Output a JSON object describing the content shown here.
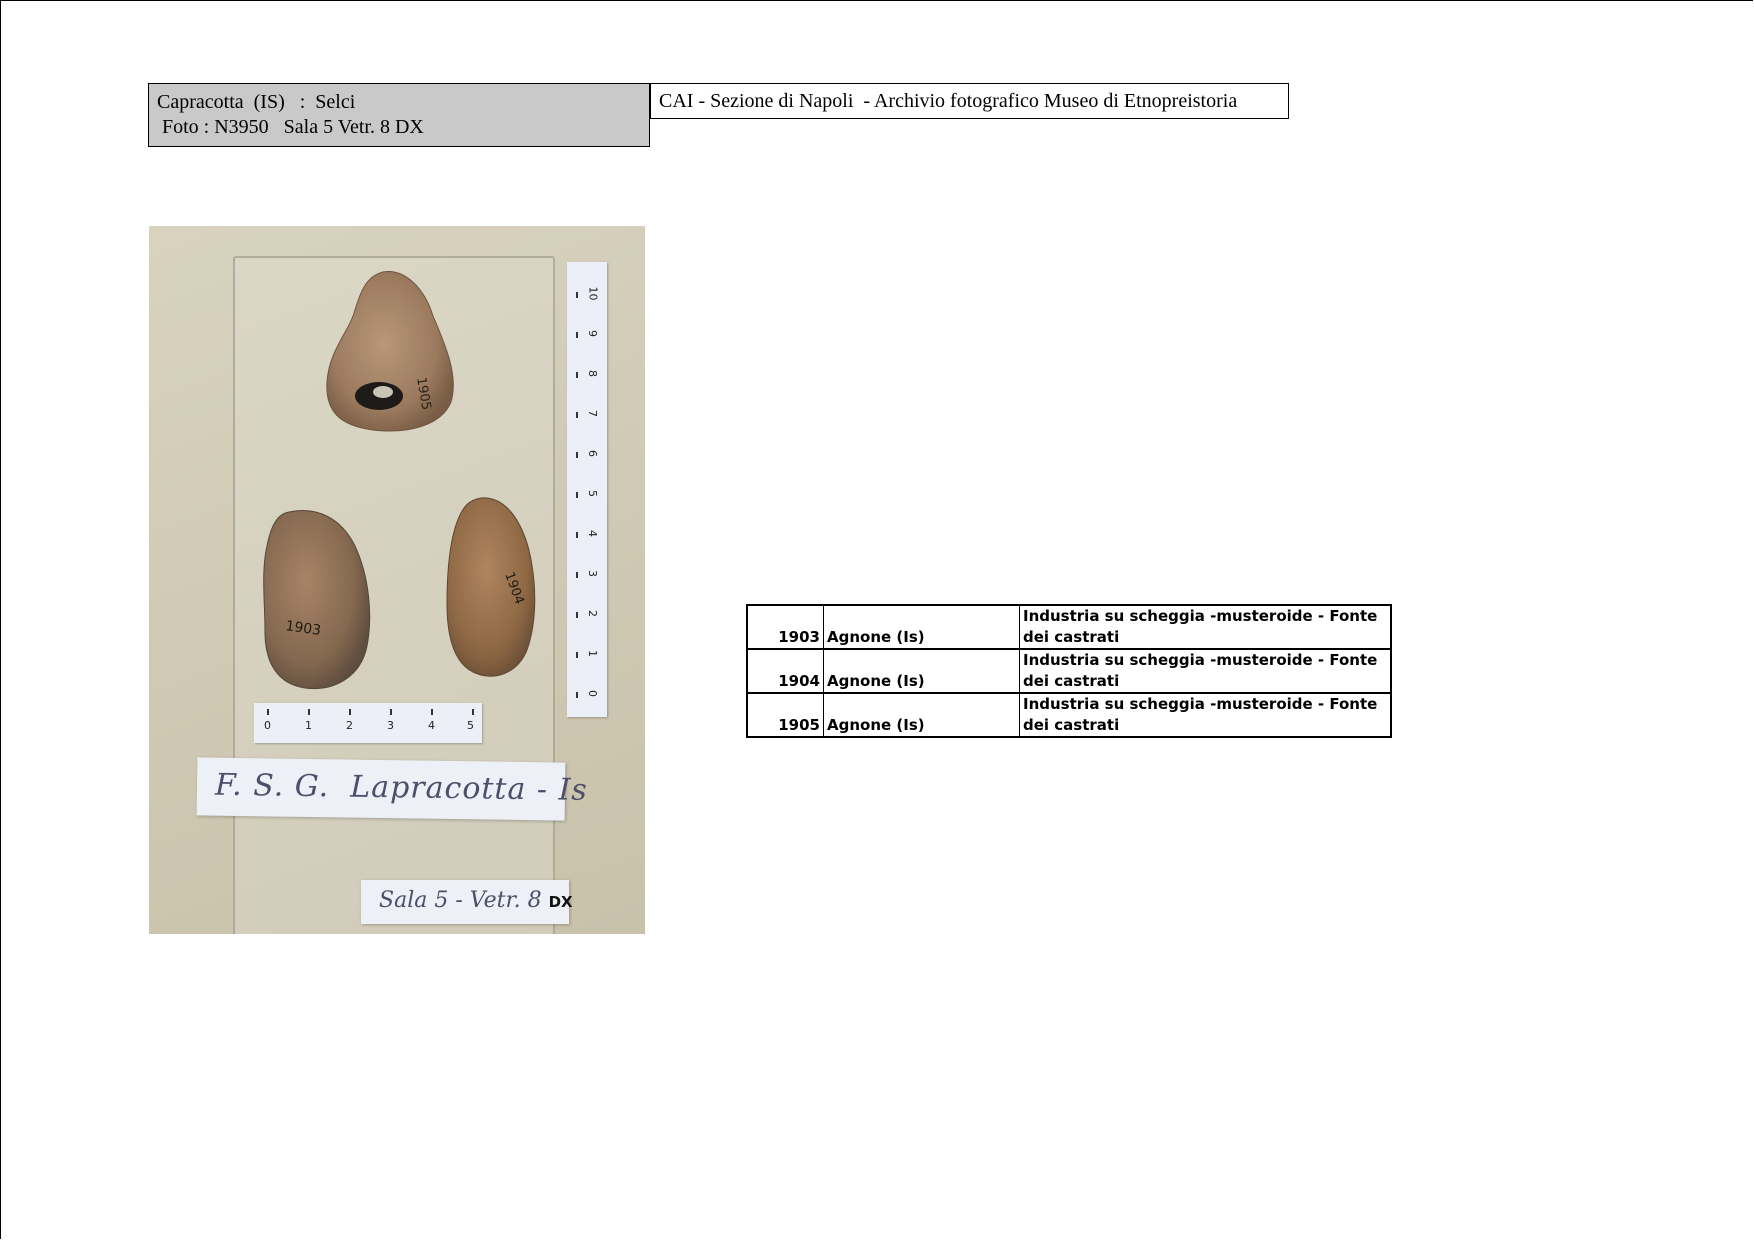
{
  "header": {
    "line1": "Capracotta  (IS)   :  Selci",
    "line2": "Foto : N3950   Sala 5 Vetr. 8 DX",
    "archive": "CAI - Sezione di Napoli  - Archivio fotografico Museo di Etnopreistoria"
  },
  "photo": {
    "card_text": "F. S. G.  Lapracotta - Is",
    "sala_text": "Sala 5 - Vetr. 8 ",
    "sala_suffix": "DX",
    "flint_numbers": [
      "1905",
      "1903",
      "1904"
    ],
    "ruler_v_numbers": [
      "0",
      "1",
      "2",
      "3",
      "4",
      "5",
      "6",
      "7",
      "8",
      "9",
      "10"
    ],
    "ruler_h_numbers": [
      "0",
      "1",
      "2",
      "3",
      "4",
      "5"
    ]
  },
  "table": {
    "rows": [
      {
        "num": "1903",
        "place": "Agnone  (Is)",
        "desc": "Industria su scheggia -musteroide - Fonte dei castrati"
      },
      {
        "num": "1904",
        "place": "Agnone  (Is)",
        "desc": "Industria su scheggia -musteroide - Fonte dei castrati"
      },
      {
        "num": "1905",
        "place": "Agnone  (Is)",
        "desc": "Industria su scheggia -musteroide - Fonte dei castrati"
      }
    ]
  }
}
